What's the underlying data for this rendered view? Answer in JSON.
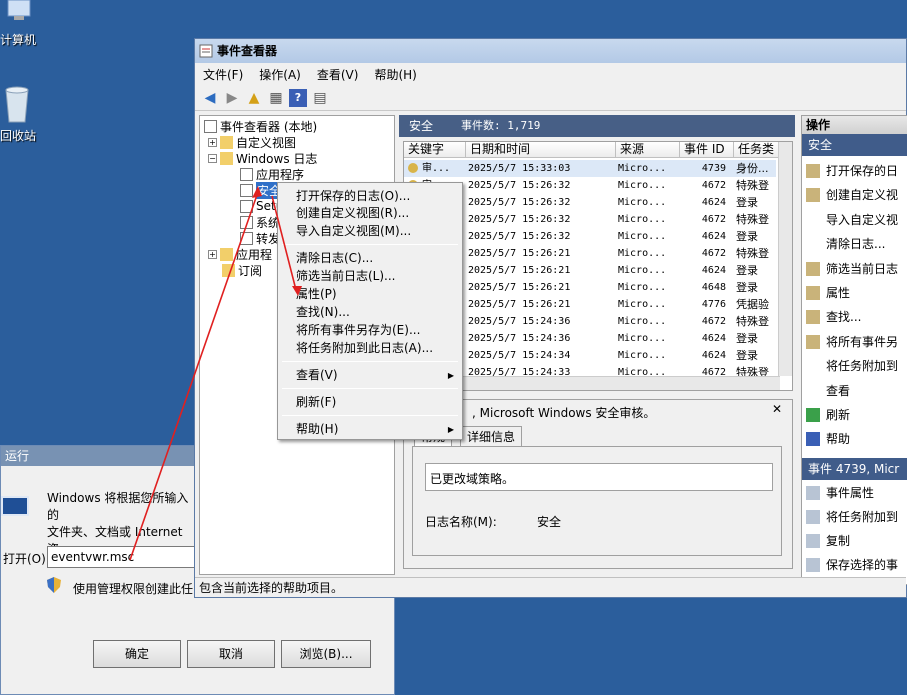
{
  "desktop": {
    "computer_label": "计算机",
    "recycle_label": "回收站"
  },
  "run_dialog": {
    "title": "运行",
    "message_line1": "Windows 将根据您所输入的",
    "message_line2": "文件夹、文档或 Internet 资",
    "open_label": "打开(O):",
    "open_value": "eventvwr.msc",
    "admin_text": "使用管理权限创建此任",
    "ok": "确定",
    "cancel": "取消",
    "browse": "浏览(B)..."
  },
  "window": {
    "title": "事件查看器",
    "menu": [
      "文件(F)",
      "操作(A)",
      "查看(V)",
      "帮助(H)"
    ]
  },
  "tree": {
    "root": "事件查看器 (本地)",
    "custom_views": "自定义视图",
    "windows_logs": "Windows 日志",
    "application": "应用程序",
    "security": "安全",
    "setup": "Setu",
    "system": "系统",
    "forwarded": "转发",
    "apps_services": "应用程",
    "subscriptions": "订阅"
  },
  "center": {
    "log_name": "安全",
    "event_count": "事件数: 1,719",
    "columns": [
      "关键字",
      "日期和时间",
      "来源",
      "事件 ID",
      "任务类"
    ],
    "rows": [
      {
        "kw": "审...",
        "dt": "2025/5/7 15:33:03",
        "src": "Micro...",
        "id": "4739",
        "cat": "身份..."
      },
      {
        "kw": "审...",
        "dt": "2025/5/7 15:26:32",
        "src": "Micro...",
        "id": "4672",
        "cat": "特殊登"
      },
      {
        "kw": "",
        "dt": "2025/5/7 15:26:32",
        "src": "Micro...",
        "id": "4624",
        "cat": "登录"
      },
      {
        "kw": "",
        "dt": "2025/5/7 15:26:32",
        "src": "Micro...",
        "id": "4672",
        "cat": "特殊登"
      },
      {
        "kw": "",
        "dt": "2025/5/7 15:26:32",
        "src": "Micro...",
        "id": "4624",
        "cat": "登录"
      },
      {
        "kw": "",
        "dt": "2025/5/7 15:26:21",
        "src": "Micro...",
        "id": "4672",
        "cat": "特殊登"
      },
      {
        "kw": "",
        "dt": "2025/5/7 15:26:21",
        "src": "Micro...",
        "id": "4624",
        "cat": "登录"
      },
      {
        "kw": "",
        "dt": "2025/5/7 15:26:21",
        "src": "Micro...",
        "id": "4648",
        "cat": "登录"
      },
      {
        "kw": "",
        "dt": "2025/5/7 15:26:21",
        "src": "Micro...",
        "id": "4776",
        "cat": "凭据验"
      },
      {
        "kw": "",
        "dt": "2025/5/7 15:24:36",
        "src": "Micro...",
        "id": "4672",
        "cat": "特殊登"
      },
      {
        "kw": "",
        "dt": "2025/5/7 15:24:36",
        "src": "Micro...",
        "id": "4624",
        "cat": "登录"
      },
      {
        "kw": "",
        "dt": "2025/5/7 15:24:34",
        "src": "Micro...",
        "id": "4624",
        "cat": "登录"
      },
      {
        "kw": "",
        "dt": "2025/5/7 15:24:33",
        "src": "Micro...",
        "id": "4672",
        "cat": "特殊登"
      }
    ],
    "detail_title": ", Microsoft Windows 安全审核。",
    "tab_general": "常规",
    "tab_details": "详细信息",
    "detail_text": "已更改域策略。",
    "log_name_label": "日志名称(M):",
    "log_name_value": "安全"
  },
  "actions": {
    "header": "操作",
    "section1": "安全",
    "items1": [
      "打开保存的日",
      "创建自定义视",
      "导入自定义视",
      "清除日志...",
      "筛选当前日志",
      "属性",
      "查找...",
      "将所有事件另",
      "将任务附加到",
      "查看",
      "刷新",
      "帮助"
    ],
    "section2": "事件 4739, Micr",
    "items2": [
      "事件属性",
      "将任务附加到",
      "复制",
      "保存选择的事"
    ]
  },
  "status_text": "包含当前选择的帮助项目。",
  "context_menu": {
    "items": [
      "打开保存的日志(O)...",
      "创建自定义视图(R)...",
      "导入自定义视图(M)...",
      "清除日志(C)...",
      "筛选当前日志(L)...",
      "属性(P)",
      "查找(N)...",
      "将所有事件另存为(E)...",
      "将任务附加到此日志(A)...",
      "查看(V)",
      "刷新(F)",
      "帮助(H)"
    ]
  },
  "colors": {
    "desktop": "#2b5e9c",
    "header_blue": "#475f86",
    "arrow": "#e02020"
  }
}
